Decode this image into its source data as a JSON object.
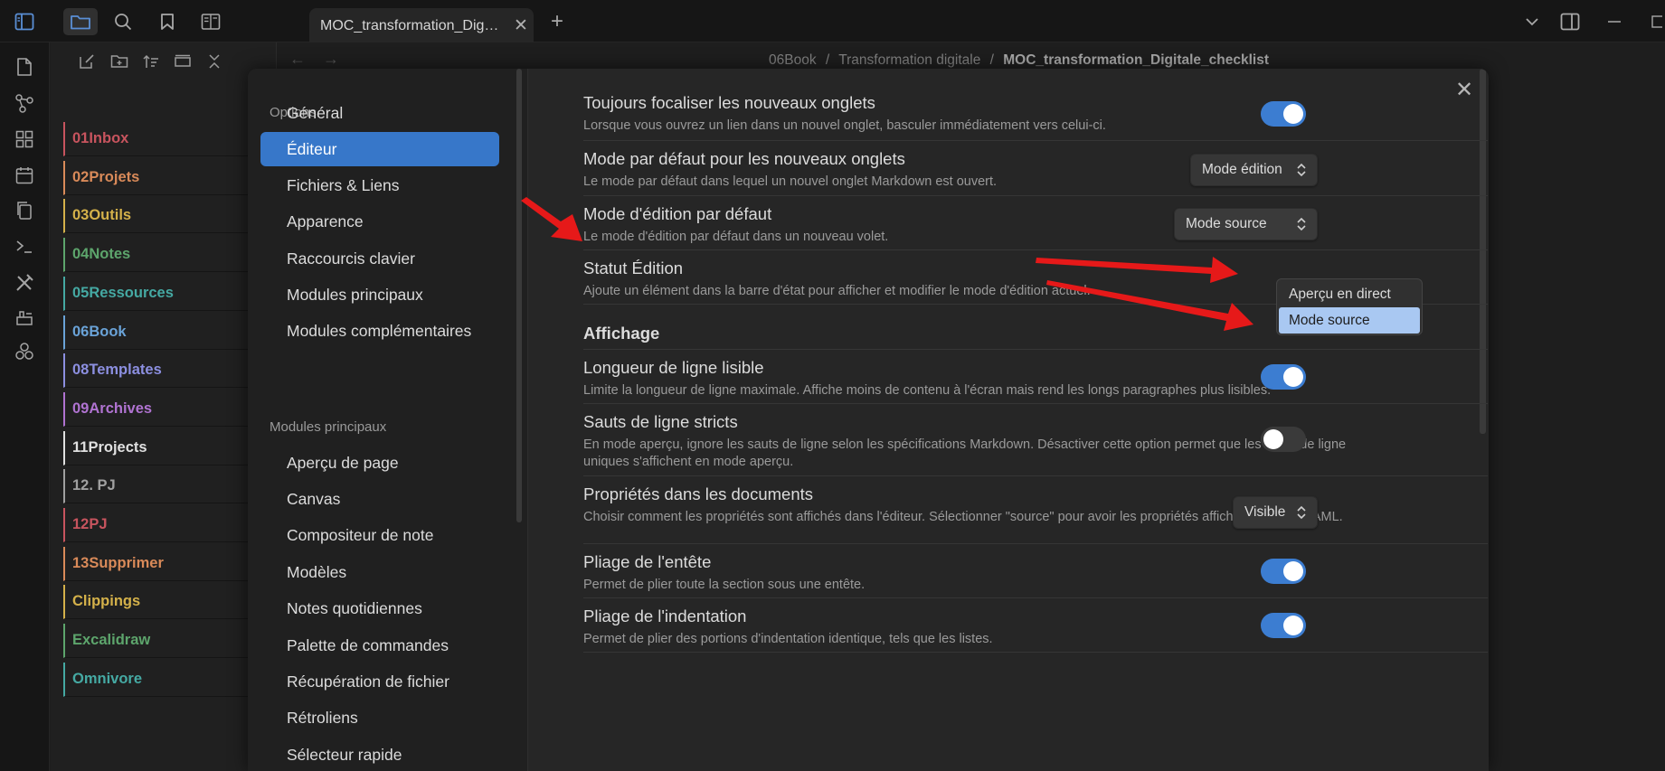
{
  "tab": {
    "title": "MOC_transformation_Digitale_checklist"
  },
  "breadcrumb": {
    "part1": "06Book",
    "part2": "Transformation digitale",
    "current": "MOC_transformation_Digitale_checklist",
    "sep": "/"
  },
  "explorer": {
    "folders": [
      {
        "label": "01Inbox",
        "color": "#c7545e"
      },
      {
        "label": "02Projets",
        "color": "#d98a59"
      },
      {
        "label": "03Outils",
        "color": "#d4b14a"
      },
      {
        "label": "04Notes",
        "color": "#5da56c"
      },
      {
        "label": "05Ressources",
        "color": "#45a9a3"
      },
      {
        "label": "06Book",
        "color": "#6aa3d8"
      },
      {
        "label": "08Templates",
        "color": "#8c8fe0"
      },
      {
        "label": "09Archives",
        "color": "#b073d1"
      },
      {
        "label": "11Projects",
        "color": "#e0e0e0"
      },
      {
        "label": "12. PJ",
        "color": "#a0a0a0"
      },
      {
        "label": "12PJ",
        "color": "#c7545e"
      },
      {
        "label": "13Supprimer",
        "color": "#d98a59"
      },
      {
        "label": "Clippings",
        "color": "#d4b14a"
      },
      {
        "label": "Excalidraw",
        "color": "#5da56c"
      },
      {
        "label": "Omnivore",
        "color": "#45a9a3"
      }
    ]
  },
  "settings_nav": {
    "options_header": "Options",
    "options": [
      "Général",
      "Éditeur",
      "Fichiers & Liens",
      "Apparence",
      "Raccourcis clavier",
      "Modules principaux",
      "Modules complémentaires"
    ],
    "modules_header": "Modules principaux",
    "modules": [
      "Aperçu de page",
      "Canvas",
      "Compositeur de note",
      "Modèles",
      "Notes quotidiennes",
      "Palette de commandes",
      "Récupération de fichier",
      "Rétroliens",
      "Sélecteur rapide"
    ]
  },
  "settings": {
    "focus_tabs": {
      "title": "Toujours focaliser les nouveaux onglets",
      "desc": "Lorsque vous ouvrez un lien dans un nouvel onglet, basculer immédiatement vers celui-ci."
    },
    "default_tab_mode": {
      "title": "Mode par défaut pour les nouveaux onglets",
      "desc": "Le mode par défaut dans lequel un nouvel onglet Markdown est ouvert.",
      "value": "Mode édition"
    },
    "default_edit_mode": {
      "title": "Mode d'édition par défaut",
      "desc": "Le mode d'édition par défaut dans un nouveau volet.",
      "value": "Mode source",
      "options": [
        "Aperçu en direct",
        "Mode source"
      ]
    },
    "status_edit": {
      "title": "Statut Édition",
      "desc": "Ajoute un élément dans la barre d'état pour afficher et modifier le mode d'édition actuel."
    },
    "display_header": "Affichage",
    "readable_line": {
      "title": "Longueur de ligne lisible",
      "desc": "Limite la longueur de ligne maximale. Affiche moins de contenu à l'écran mais rend les longs paragraphes plus lisibles."
    },
    "strict_breaks": {
      "title": "Sauts de ligne stricts",
      "desc": "En mode aperçu, ignore les sauts de ligne selon les spécifications Markdown. Désactiver cette option permet que les sauts de ligne uniques s'affichent en mode aperçu."
    },
    "properties": {
      "title": "Propriétés dans les documents",
      "desc": "Choisir comment les propriétés sont affichés dans l'éditeur. Sélectionner \"source\" pour avoir les propriétés affichées comme YAML.",
      "value": "Visible"
    },
    "fold_heading": {
      "title": "Pliage de l'entête",
      "desc": "Permet de plier toute la section sous une entête."
    },
    "fold_indent": {
      "title": "Pliage de l'indentation",
      "desc": "Permet de plier des portions d'indentation identique, tels que les listes."
    }
  },
  "colors": {
    "accent": "#3c7dd1",
    "nav_active": "#3777c9",
    "annotation_arrow": "#e61919"
  }
}
